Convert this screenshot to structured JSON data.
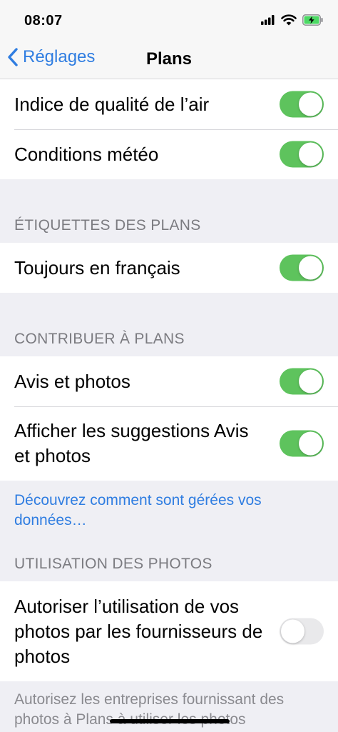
{
  "status": {
    "time": "08:07"
  },
  "nav": {
    "back_label": "Réglages",
    "title": "Plans"
  },
  "group1": {
    "items": [
      {
        "label": "Indice de qualité de l’air",
        "on": true
      },
      {
        "label": "Conditions météo",
        "on": true
      }
    ]
  },
  "section_labels": {
    "header": "ÉTIQUETTES DES PLANS",
    "items": [
      {
        "label": "Toujours en français",
        "on": true
      }
    ]
  },
  "section_contribute": {
    "header": "CONTRIBUER À PLANS",
    "items": [
      {
        "label": "Avis et photos",
        "on": true
      },
      {
        "label": "Afficher les suggestions Avis et photos",
        "on": true
      }
    ],
    "footer_link": "Découvrez comment sont gérées vos données…"
  },
  "section_photos": {
    "header": "UTILISATION DES PHOTOS",
    "items": [
      {
        "label": "Autoriser l’utilisation de vos photos par les fournisseurs de photos",
        "on": false
      }
    ],
    "footer": "Autorisez les entreprises fournissant des photos à Plans à utiliser les photos"
  },
  "colors": {
    "accent": "#2f7de1",
    "toggle_on": "#5ec35d",
    "toggle_off": "#e9e9eb",
    "background": "#efeff4"
  },
  "icons": [
    "cellular-signal-icon",
    "wifi-icon",
    "battery-charging-icon",
    "chevron-left-icon"
  ]
}
